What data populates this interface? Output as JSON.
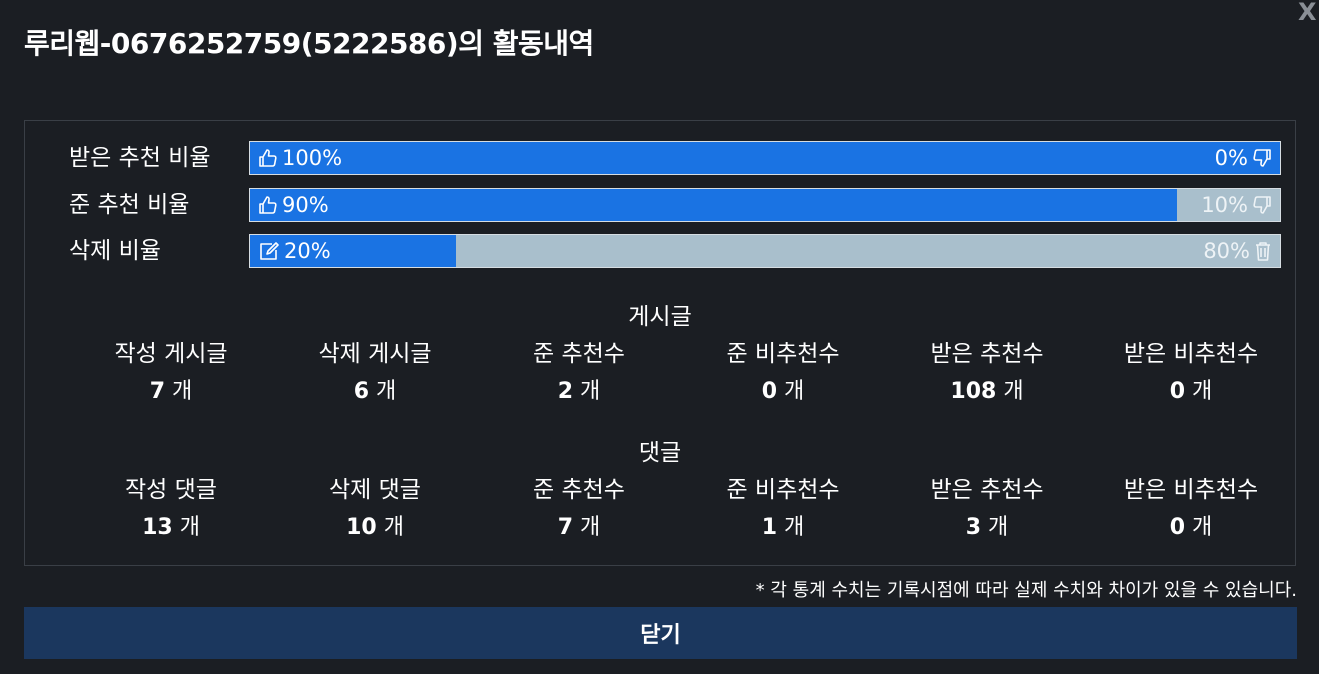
{
  "header": {
    "title": "루리웹-0676252759(5222586)의 활동내역",
    "close_glyph": "X"
  },
  "rates": [
    {
      "label": "받은 추천 비율",
      "left_value": "100%",
      "right_value": "0%",
      "fill_percent": 100,
      "left_icon": "thumbs-up-icon",
      "right_icon": "thumbs-down-icon"
    },
    {
      "label": "준 추천 비율",
      "left_value": "90%",
      "right_value": "10%",
      "fill_percent": 90,
      "left_icon": "thumbs-up-icon",
      "right_icon": "thumbs-down-icon"
    },
    {
      "label": "삭제 비율",
      "left_value": "20%",
      "right_value": "80%",
      "fill_percent": 20,
      "left_icon": "edit-icon",
      "right_icon": "trash-icon"
    }
  ],
  "posts": {
    "title": "게시글",
    "stats": [
      {
        "label": "작성 게시글",
        "value": "7",
        "unit": "개"
      },
      {
        "label": "삭제 게시글",
        "value": "6",
        "unit": "개"
      },
      {
        "label": "준 추천수",
        "value": "2",
        "unit": "개"
      },
      {
        "label": "준 비추천수",
        "value": "0",
        "unit": "개"
      },
      {
        "label": "받은 추천수",
        "value": "108",
        "unit": "개"
      },
      {
        "label": "받은 비추천수",
        "value": "0",
        "unit": "개"
      }
    ]
  },
  "comments": {
    "title": "댓글",
    "stats": [
      {
        "label": "작성 댓글",
        "value": "13",
        "unit": "개"
      },
      {
        "label": "삭제 댓글",
        "value": "10",
        "unit": "개"
      },
      {
        "label": "준 추천수",
        "value": "7",
        "unit": "개"
      },
      {
        "label": "준 비추천수",
        "value": "1",
        "unit": "개"
      },
      {
        "label": "받은 추천수",
        "value": "3",
        "unit": "개"
      },
      {
        "label": "받은 비추천수",
        "value": "0",
        "unit": "개"
      }
    ]
  },
  "note": "* 각 통계 수치는 기록시점에 따라 실제 수치와 차이가 있을 수 있습니다.",
  "footer": {
    "close_label": "닫기"
  },
  "colors": {
    "background": "#1b1e23",
    "bar_fill": "#1a73e3",
    "bar_track": "#a9bfcc",
    "close_button": "#1b375e"
  }
}
